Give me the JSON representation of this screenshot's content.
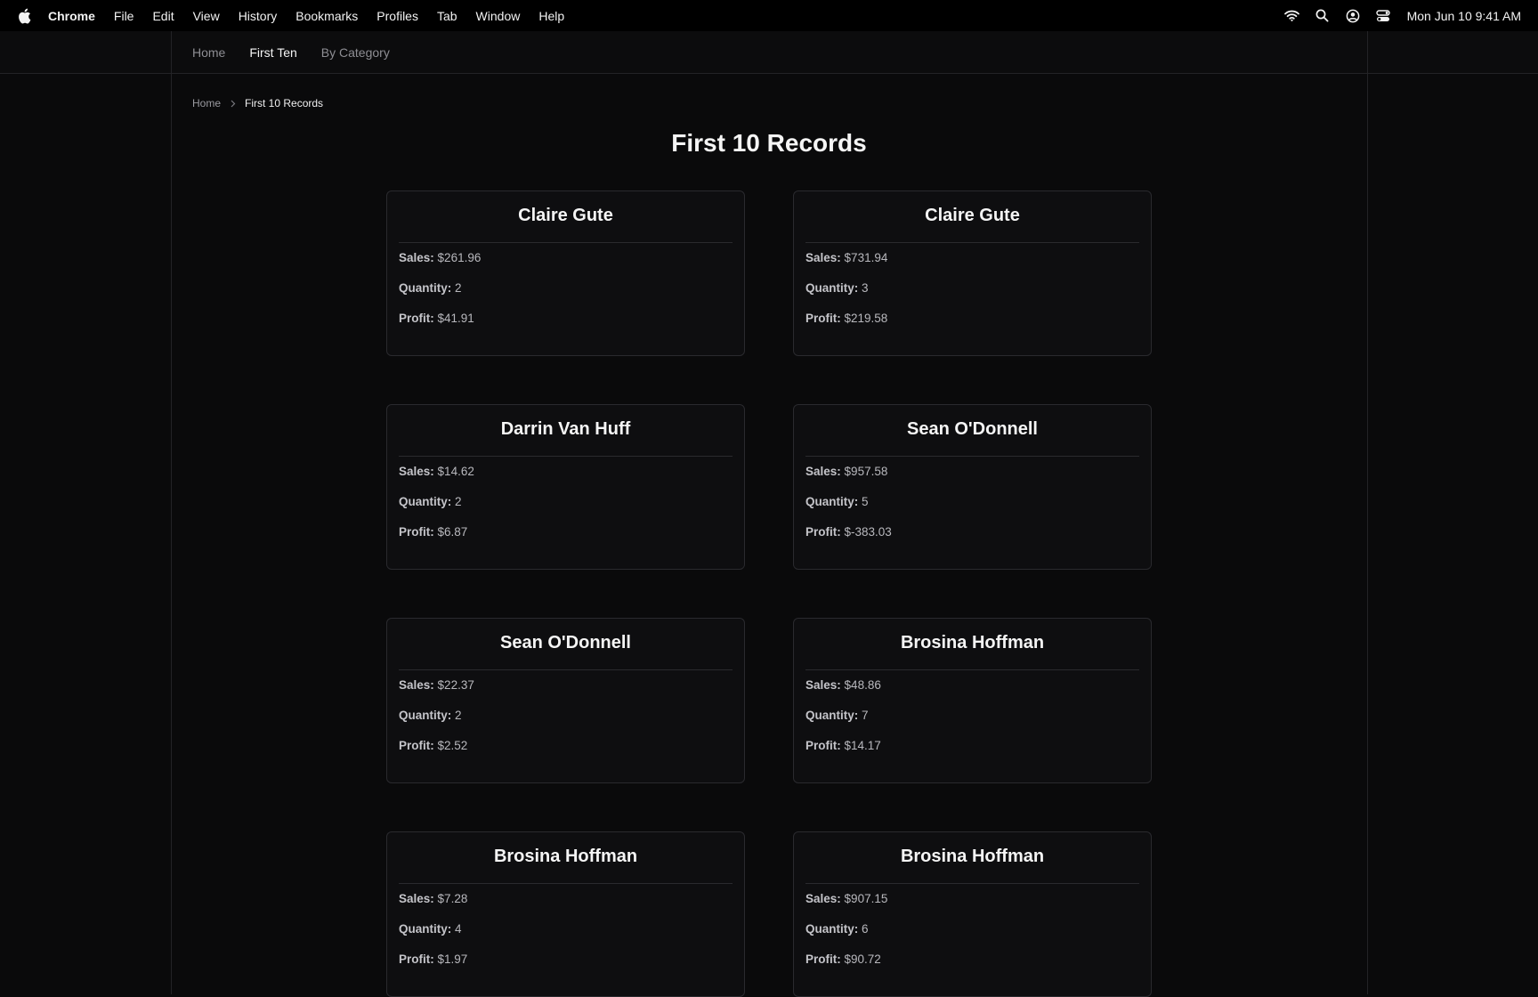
{
  "menubar": {
    "app": "Chrome",
    "items": [
      "File",
      "Edit",
      "View",
      "History",
      "Bookmarks",
      "Profiles",
      "Tab",
      "Window",
      "Help"
    ],
    "clock": "Mon Jun 10  9:41 AM",
    "status_icons": [
      "wifi-icon",
      "search-icon",
      "user-icon",
      "control-center-icon"
    ]
  },
  "nav": {
    "links": [
      "Home",
      "First Ten",
      "By Category"
    ],
    "active": "First Ten"
  },
  "breadcrumb": {
    "home": "Home",
    "current": "First 10 Records"
  },
  "page_title": "First 10 Records",
  "field_labels": {
    "sales": "Sales:",
    "quantity": "Quantity:",
    "profit": "Profit:"
  },
  "records": [
    {
      "name": "Claire Gute",
      "sales": "$261.96",
      "quantity": "2",
      "profit": "$41.91"
    },
    {
      "name": "Claire Gute",
      "sales": "$731.94",
      "quantity": "3",
      "profit": "$219.58"
    },
    {
      "name": "Darrin Van Huff",
      "sales": "$14.62",
      "quantity": "2",
      "profit": "$6.87"
    },
    {
      "name": "Sean O'Donnell",
      "sales": "$957.58",
      "quantity": "5",
      "profit": "$-383.03"
    },
    {
      "name": "Sean O'Donnell",
      "sales": "$22.37",
      "quantity": "2",
      "profit": "$2.52"
    },
    {
      "name": "Brosina Hoffman",
      "sales": "$48.86",
      "quantity": "7",
      "profit": "$14.17"
    },
    {
      "name": "Brosina Hoffman",
      "sales": "$7.28",
      "quantity": "4",
      "profit": "$1.97"
    },
    {
      "name": "Brosina Hoffman",
      "sales": "$907.15",
      "quantity": "6",
      "profit": "$90.72"
    }
  ]
}
